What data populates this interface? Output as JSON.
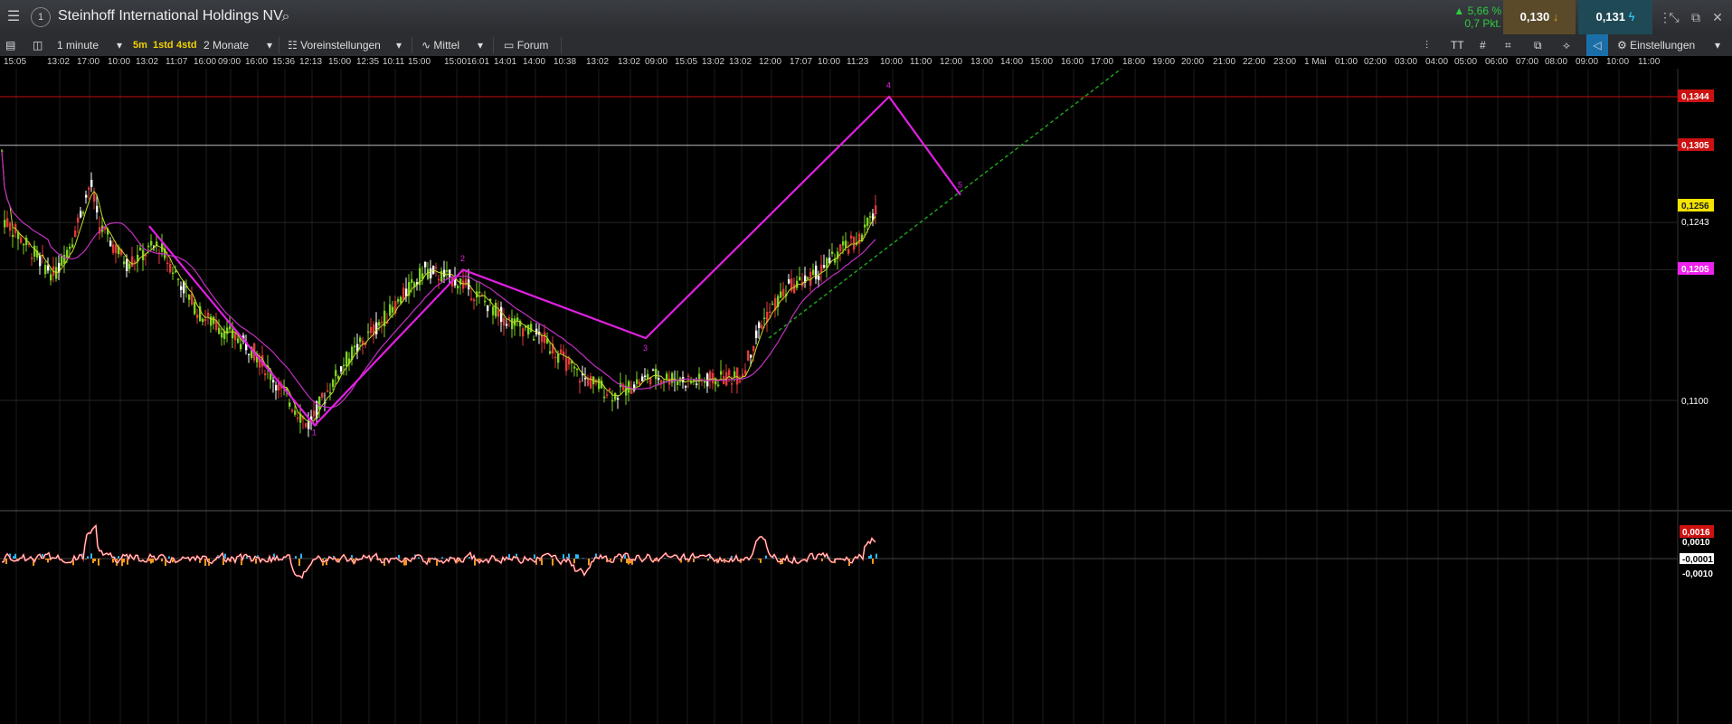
{
  "window": {
    "title": "Steinhoff International Holdings NV"
  },
  "quote": {
    "change_pct": "▲ 5,66 %",
    "change_pts": "0,7 Pkt.",
    "bid": "0,130",
    "ask": "0,131"
  },
  "toolbar": {
    "interval": "1 minute",
    "presets": [
      "5m",
      "1std",
      "4std"
    ],
    "range": "2 Monate",
    "settings_preset": "Voreinstellungen",
    "indicator": "Mittel",
    "forum": "Forum",
    "settings": "Einstellungen"
  },
  "time_axis": [
    "15:05",
    "13:02",
    "17:00",
    "10:00",
    "13:02",
    "11:07",
    "16:00",
    "09:00",
    "16:00",
    "15:36",
    "12:13",
    "15:00",
    "12:35",
    "10:11",
    "15:00",
    "15:00",
    "16:01",
    "14:01",
    "14:00",
    "10:38",
    "13:02",
    "13:02",
    "09:00",
    "15:05",
    "13:02",
    "13:02",
    "12:00",
    "17:07",
    "10:00",
    "11:23",
    "10:00",
    "11:00",
    "12:00",
    "13:00",
    "14:00",
    "15:00",
    "16:00",
    "17:00",
    "18:00",
    "19:00",
    "20:00",
    "21:00",
    "22:00",
    "23:00",
    "1 Mai",
    "01:00",
    "02:00",
    "03:00",
    "04:00",
    "05:00",
    "06:00",
    "07:00",
    "08:00",
    "09:00",
    "10:00",
    "11:00"
  ],
  "price_scale": {
    "levels": [
      "0,1344",
      "0,1305",
      "0,1256",
      "0,1243",
      "0,1205",
      "0,1100"
    ],
    "colors": {
      "0,1344": "#cc1111",
      "0,1305": "#cc1111",
      "0,1256": "#f5e400",
      "0,1243": "#000000",
      "0,1205": "#ee22ee",
      "0,1100": "#000000"
    }
  },
  "oscillator_scale": {
    "levels": [
      "0,0016",
      "0,0010",
      "-0,0001",
      "-0,0010"
    ]
  },
  "pattern_labels": [
    "1",
    "2",
    "3",
    "4",
    "5"
  ],
  "colors": {
    "up": "#7ed321",
    "down": "#e23a3a",
    "white": "#ffffff",
    "pattern": "#e020e0",
    "ma_fast": "#c8d82a",
    "ma_slow": "#c030c0",
    "trend": "#1e9e1e"
  }
}
